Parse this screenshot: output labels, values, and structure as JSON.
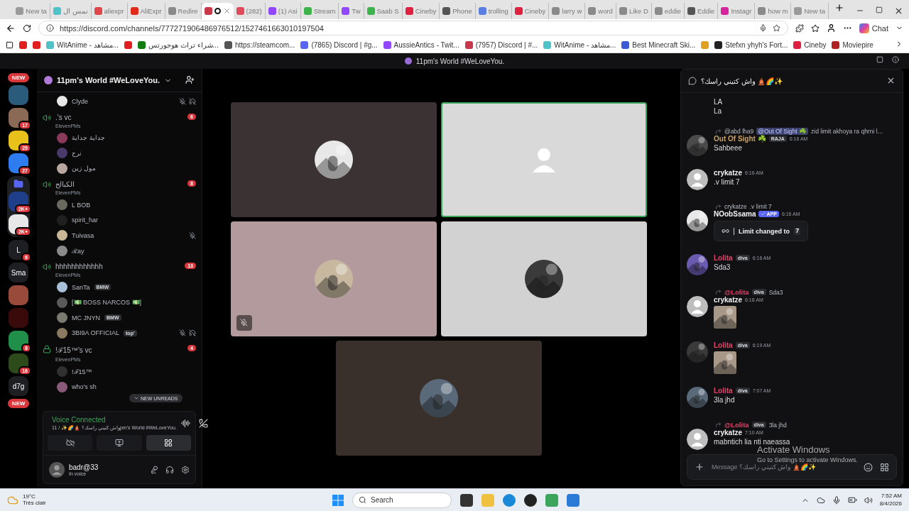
{
  "browser": {
    "tabs": [
      {
        "label": "New ta",
        "color": "#9a9a9a",
        "selected": false
      },
      {
        "label": "نمس ال",
        "color": "#4fc3c8",
        "selected": false
      },
      {
        "label": "aliexpr",
        "color": "#e0464a",
        "selected": false
      },
      {
        "label": "AliExpr",
        "color": "#e02a1a",
        "selected": false
      },
      {
        "label": "Redire",
        "color": "#8a8a8a",
        "selected": false
      },
      {
        "color": "#c8384a",
        "selected": true
      },
      {
        "label": "(282)",
        "color": "#e04a5a",
        "selected": false
      },
      {
        "label": "(1) Asi",
        "color": "#9146ff",
        "selected": false
      },
      {
        "label": "Stream",
        "color": "#3cb44b",
        "selected": false
      },
      {
        "label": "Tw",
        "color": "#9146ff",
        "selected": false
      },
      {
        "label": "Saab S",
        "color": "#3cb44b",
        "selected": false
      },
      {
        "label": "Cineby",
        "color": "#e02040",
        "selected": false
      },
      {
        "label": "Phone",
        "color": "#555555",
        "selected": false
      },
      {
        "label": "trolling",
        "color": "#5b7fe0",
        "selected": false
      },
      {
        "label": "Cineby",
        "color": "#e02040",
        "selected": false
      },
      {
        "label": "larry w",
        "color": "#8a8a8a",
        "selected": false
      },
      {
        "label": "word",
        "color": "#8a8a8a",
        "selected": false
      },
      {
        "label": "Like D",
        "color": "#8a8a8a",
        "selected": false
      },
      {
        "label": "eddie",
        "color": "#8a8a8a",
        "selected": false
      },
      {
        "label": "Eddie",
        "color": "#555555",
        "selected": false
      },
      {
        "label": "Instagr",
        "color": "#d6249f",
        "selected": false
      },
      {
        "label": "how m",
        "color": "#8a8a8a",
        "selected": false
      },
      {
        "label": "New ta",
        "color": "#9a9a9a",
        "selected": false
      }
    ],
    "url": "https://discord.com/channels/777271906486976512/1527461663010197504",
    "copilot_label": "Chat",
    "bookmarks": [
      {
        "color": "#e02020"
      },
      {
        "color": "#e02020"
      },
      {
        "label": "WitAnime - مشاهد...",
        "color": "#4fc3c8"
      },
      {
        "color": "#e02020"
      },
      {
        "label": "شراء تراث هوجورتس...",
        "color": "#107c10"
      },
      {
        "label": "https://steamcom...",
        "color": "#555555"
      },
      {
        "label": "(7865) Discord | #g...",
        "color": "#5865f2"
      },
      {
        "label": "AussieAntics - Twit...",
        "color": "#9146ff"
      },
      {
        "label": "(7957) Discord | #...",
        "color": "#c8384a"
      },
      {
        "label": "WitAnime - مشاهد...",
        "color": "#4fc3c8"
      },
      {
        "label": "Best Minecraft Ski...",
        "color": "#3b5bd6"
      },
      {
        "color": "#e0a020"
      },
      {
        "label": "Stefxn yhyh's Fort...",
        "color": "#222222"
      },
      {
        "label": "Cineby",
        "color": "#e02040"
      },
      {
        "label": "Moviepire",
        "color": "#b02020"
      }
    ]
  },
  "discord": {
    "title": "11pm's World #WeLoveYou.",
    "servers": [
      {
        "kind": "pill",
        "label": "NEW"
      },
      {
        "kind": "avatar",
        "color": "#2a5b7a"
      },
      {
        "kind": "avatar",
        "color": "#8a6a55",
        "badge": "17"
      },
      {
        "kind": "avatar",
        "color": "#e8c21a",
        "badge": "29"
      },
      {
        "kind": "avatar",
        "color": "#2f7bf0",
        "badge": "27"
      },
      {
        "kind": "folder",
        "children": [
          {
            "kind": "avatar",
            "color": "#1f3f8a",
            "badge": "2K+"
          },
          {
            "kind": "avatar",
            "color": "#e8e8e8",
            "badge": "2K+"
          }
        ]
      },
      {
        "kind": "letters",
        "label": "L",
        "badge": "6"
      },
      {
        "kind": "letters",
        "label": "Sma"
      },
      {
        "kind": "avatar",
        "color": "#9a4a3a"
      },
      {
        "kind": "avatar",
        "color": "#3a0a0a"
      },
      {
        "kind": "avatar",
        "color": "#1f8f4a",
        "badge": "8"
      },
      {
        "kind": "avatar",
        "color": "#2c4a1a",
        "badge": "16"
      },
      {
        "kind": "letters",
        "label": "d7g"
      },
      {
        "kind": "pill",
        "label": "NEW"
      }
    ],
    "server_name": "11pm's World #WeLoveYou.",
    "channel_items": [
      {
        "kind": "member",
        "name": "Clyde",
        "color": "#e8e8e8",
        "muted": true,
        "deafened": true
      },
      {
        "kind": "channel",
        "name": ".'s vc",
        "subtitle": "ElevenPMs",
        "badge": "6",
        "locked": false
      },
      {
        "kind": "member",
        "name": "جداية جداية",
        "color": "#8a3a5a",
        "muted": false,
        "deafened": false
      },
      {
        "kind": "member",
        "name": "نرج",
        "color": "#4a3a6a",
        "muted": false,
        "deafened": false
      },
      {
        "kind": "member",
        "name": "مول زين",
        "color": "#b8a8a0",
        "muted": false,
        "deafened": false
      },
      {
        "kind": "channel",
        "name": "الكبالح",
        "subtitle": "ElevenPMs",
        "badge": "8",
        "locked": false
      },
      {
        "kind": "member",
        "name": "L BOB",
        "color": "#6a6a60",
        "muted": false,
        "deafened": false
      },
      {
        "kind": "member",
        "name": "spirit_har",
        "color": "#202020",
        "muted": false,
        "deafened": false
      },
      {
        "kind": "member",
        "name": "Tuivasa",
        "color": "#c8b898",
        "muted": true,
        "deafened": false
      },
      {
        "kind": "member",
        "name": "ℛay",
        "color": "#8a8a8a",
        "muted": false,
        "deafened": false
      },
      {
        "kind": "channel",
        "name": "hhhhhhhhhhhh",
        "subtitle": "ElevenPMs",
        "badge": "13",
        "locked": false
      },
      {
        "kind": "member",
        "name": "SanTa",
        "tag": "BMW",
        "color": "#a8c0d8",
        "muted": false,
        "deafened": false
      },
      {
        "kind": "member",
        "name": "[💵 BOSS NARCOS 💵]",
        "color": "#5a5a5a",
        "muted": false,
        "deafened": false
      },
      {
        "kind": "member",
        "name": "MC JNYN",
        "tag": "BMW",
        "color": "#7a7a70",
        "muted": false,
        "deafened": false
      },
      {
        "kind": "member",
        "name": "3BI9A OFFICIAL",
        "tag": "top'",
        "color": "#8a7a60",
        "muted": true,
        "deafened": true
      },
      {
        "kind": "channel",
        "name": "!ℱ15™'s vc",
        "subtitle": "ElevenPMs",
        "badge": "4",
        "locked": true
      },
      {
        "kind": "member",
        "name": "!ℱ15™",
        "color": "#303030",
        "muted": false,
        "deafened": false
      },
      {
        "kind": "member",
        "name": "who's sh",
        "color": "#8a5a7a",
        "muted": false,
        "deafened": false
      }
    ],
    "new_unreads": "NEW UNREADS",
    "voice": {
      "status": "Voice Connected",
      "location": "11 / ✨🌈🛕 واش كتيني راسك؟pm's World #WeLoveYou."
    },
    "user": {
      "name": "badr@33",
      "status": "In voice"
    },
    "tiles": [
      {
        "color": "#3b3233",
        "default_avatar": false,
        "speaking": false,
        "muted": false
      },
      {
        "color": "#d9d9d9",
        "default_avatar": true,
        "speaking": true,
        "muted": false
      },
      {
        "color": "#b39b9d",
        "default_avatar": false,
        "speaking": false,
        "muted": true
      },
      {
        "color": "#d2d2d2",
        "default_avatar": false,
        "speaking": false,
        "muted": false
      },
      {
        "color": "#3a302b",
        "default_avatar": false,
        "speaking": false,
        "muted": false
      }
    ],
    "chat": {
      "title": "واش كتيني راسك؟ 🛕🌈✨",
      "messages": [
        {
          "kind": "continuation",
          "lines": [
            "LA",
            "La"
          ]
        },
        {
          "kind": "message",
          "reply": {
            "name": "@abd lha9",
            "mention": "@Out Of Sight ☘️",
            "text": "zid limit akhoya ra qhrni l..."
          },
          "default_avatar": false,
          "author": "Out Of Sight ☘️",
          "color": "#c9a267",
          "tag": "RAJA",
          "time": "6:16 AM",
          "lines": [
            "Sahbeee"
          ]
        },
        {
          "kind": "message",
          "default_avatar": true,
          "author": "crykatze",
          "color": "#f2f3f5",
          "time": "6:16 AM",
          "lines": [
            ".v limit 7"
          ]
        },
        {
          "kind": "message",
          "reply": {
            "name": "crykatze",
            "text": ".v limit 7"
          },
          "default_avatar": false,
          "author": "NOobSsama",
          "color": "#f2f3f5",
          "app": "APP",
          "time": "6:16 AM",
          "embed": {
            "text": "Limit changed to",
            "value": "7"
          }
        },
        {
          "kind": "message",
          "default_avatar": false,
          "author": "Lolita",
          "color": "#e0436a",
          "tag": "diva",
          "time": "6:16 AM",
          "lines": [
            "Sda3"
          ]
        },
        {
          "kind": "message",
          "reply": {
            "name": "@Lolita",
            "color": "#e0436a",
            "tag": "diva",
            "text": "Sda3"
          },
          "default_avatar": true,
          "author": "crykatze",
          "color": "#f2f3f5",
          "time": "6:18 AM",
          "image": true
        },
        {
          "kind": "message",
          "default_avatar": false,
          "author": "Lolita",
          "color": "#e0436a",
          "tag": "diva",
          "time": "6:19 AM",
          "image": true
        },
        {
          "kind": "message",
          "default_avatar": false,
          "author": "Lolita",
          "color": "#e0436a",
          "tag": "diva",
          "time": "7:07 AM",
          "lines": [
            "3la jhd"
          ]
        },
        {
          "kind": "message",
          "reply": {
            "name": "@Lolita",
            "color": "#e0436a",
            "tag": "diva",
            "text": "3la jhd"
          },
          "default_avatar": true,
          "author": "crykatze",
          "color": "#f2f3f5",
          "time": "7:10 AM",
          "lines": [
            "mabntich lia nti naeassa"
          ]
        }
      ],
      "placeholder": "Message واش كتيني راسك؟ 🛕🌈✨"
    }
  },
  "os_notice": {
    "title": "Activate Windows",
    "text": "Go to Settings to activate Windows."
  },
  "taskbar": {
    "weather_temp": "19°C",
    "weather_text": "Très clair",
    "search": "Search",
    "time": "7:52 AM",
    "date": "8/4/2026"
  }
}
